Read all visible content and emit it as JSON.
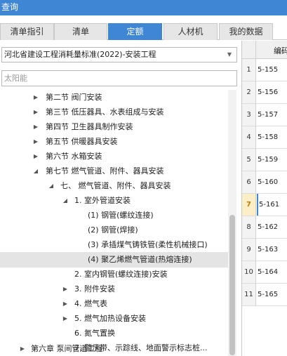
{
  "window": {
    "title": "查询"
  },
  "tabs": [
    {
      "label": "清单指引",
      "active": false
    },
    {
      "label": "清单",
      "active": false
    },
    {
      "label": "定额",
      "active": true
    },
    {
      "label": "人材机",
      "active": false
    },
    {
      "label": "我的数据",
      "active": false
    }
  ],
  "library_select": {
    "value": "河北省建设工程消耗量标准(2022)-安装工程"
  },
  "search": {
    "placeholder": "太阳能"
  },
  "tree": [
    {
      "label": "第二节 阀门安装",
      "toggle": "▶",
      "expanded": false
    },
    {
      "label": "第三节 低压器具、水表组成与安装",
      "toggle": "▶",
      "expanded": false
    },
    {
      "label": "第四节 卫生器具制作安装",
      "toggle": "▶",
      "expanded": false
    },
    {
      "label": "第五节 供暖器具安装",
      "toggle": "▶",
      "expanded": false
    },
    {
      "label": "第六节 水箱安装",
      "toggle": "▶",
      "expanded": false
    },
    {
      "label": "第七节 燃气管道、附件、器具安装",
      "toggle": "◢",
      "expanded": true
    },
    {
      "label": "七、 燃气管道、附件、器具安装",
      "toggle": "◢",
      "expanded": true
    },
    {
      "label": "1. 室外管道安装",
      "toggle": "◢",
      "expanded": true
    },
    {
      "label": "(1) 钢管(螺纹连接)",
      "toggle": "",
      "expanded": false
    },
    {
      "label": "(2) 钢管(焊接)",
      "toggle": "",
      "expanded": false
    },
    {
      "label": "(3) 承插煤气铸铁管(柔性机械接口)",
      "toggle": "",
      "expanded": false
    },
    {
      "label": "(4) 聚乙烯燃气管道(热熔连接)",
      "toggle": "",
      "expanded": false,
      "selected": true
    },
    {
      "label": "2. 室内钢管(螺纹连接)安装",
      "toggle": "",
      "expanded": false
    },
    {
      "label": "3. 附件安装",
      "toggle": "▶",
      "expanded": false
    },
    {
      "label": "4. 燃气表",
      "toggle": "▶",
      "expanded": false
    },
    {
      "label": "5. 燃气加热设备安装",
      "toggle": "▶",
      "expanded": false
    },
    {
      "label": "6. 氮气置换",
      "toggle": "",
      "expanded": false
    },
    {
      "label": "7. 警示带、示踪线、地面警示标志桩...",
      "toggle": "",
      "expanded": false
    },
    {
      "label": "第六章 泵间管道工程",
      "toggle": "▶",
      "expanded": false
    }
  ],
  "result_table": {
    "header_code": "编码",
    "rows": [
      {
        "num": "1",
        "code": "5-155"
      },
      {
        "num": "2",
        "code": "5-156"
      },
      {
        "num": "3",
        "code": "5-157"
      },
      {
        "num": "4",
        "code": "5-158"
      },
      {
        "num": "5",
        "code": "5-159"
      },
      {
        "num": "6",
        "code": "5-160"
      },
      {
        "num": "7",
        "code": "5-161",
        "current": true
      },
      {
        "num": "8",
        "code": "5-162"
      },
      {
        "num": "9",
        "code": "5-163"
      },
      {
        "num": "10",
        "code": "5-164"
      },
      {
        "num": "11",
        "code": "5-165"
      }
    ]
  },
  "colors": {
    "accent": "#3f86d4",
    "selected_row": "#e4e4e4",
    "current_row_marker": "#fcefc7"
  }
}
